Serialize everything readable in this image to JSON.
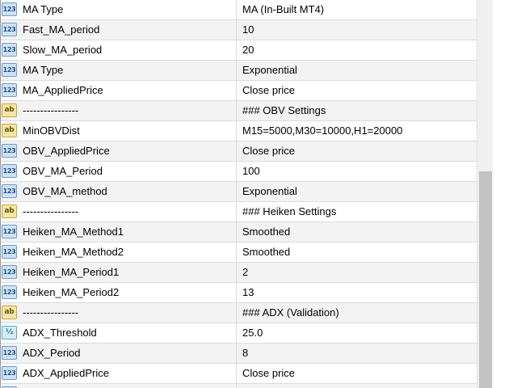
{
  "icon_labels": {
    "int": "123",
    "string": "ab",
    "double": "½"
  },
  "rows": [
    {
      "type": "int",
      "icon_name": "integer-type-icon",
      "name": "MA Type",
      "value": "MA (In-Built MT4)"
    },
    {
      "type": "int",
      "icon_name": "integer-type-icon",
      "name": "Fast_MA_period",
      "value": "10"
    },
    {
      "type": "int",
      "icon_name": "integer-type-icon",
      "name": "Slow_MA_period",
      "value": "20"
    },
    {
      "type": "int",
      "icon_name": "integer-type-icon",
      "name": "MA Type",
      "value": "Exponential"
    },
    {
      "type": "int",
      "icon_name": "integer-type-icon",
      "name": "MA_AppliedPrice",
      "value": "Close price"
    },
    {
      "type": "string",
      "icon_name": "string-type-icon",
      "name": "----------------",
      "value": "### OBV Settings"
    },
    {
      "type": "string",
      "icon_name": "string-type-icon",
      "name": "MinOBVDist",
      "value": "M15=5000,M30=10000,H1=20000"
    },
    {
      "type": "int",
      "icon_name": "integer-type-icon",
      "name": "OBV_AppliedPrice",
      "value": "Close price"
    },
    {
      "type": "int",
      "icon_name": "integer-type-icon",
      "name": "OBV_MA_Period",
      "value": "100"
    },
    {
      "type": "int",
      "icon_name": "integer-type-icon",
      "name": "OBV_MA_method",
      "value": "Exponential"
    },
    {
      "type": "string",
      "icon_name": "string-type-icon",
      "name": "----------------",
      "value": "### Heiken Settings"
    },
    {
      "type": "int",
      "icon_name": "integer-type-icon",
      "name": "Heiken_MA_Method1",
      "value": "Smoothed"
    },
    {
      "type": "int",
      "icon_name": "integer-type-icon",
      "name": "Heiken_MA_Method2",
      "value": "Smoothed"
    },
    {
      "type": "int",
      "icon_name": "integer-type-icon",
      "name": "Heiken_MA_Period1",
      "value": "2"
    },
    {
      "type": "int",
      "icon_name": "integer-type-icon",
      "name": "Heiken_MA_Period2",
      "value": "13"
    },
    {
      "type": "string",
      "icon_name": "string-type-icon",
      "name": "----------------",
      "value": "### ADX (Validation)"
    },
    {
      "type": "double",
      "icon_name": "double-type-icon",
      "name": "ADX_Threshold",
      "value": "25.0"
    },
    {
      "type": "int",
      "icon_name": "integer-type-icon",
      "name": "ADX_Period",
      "value": "8"
    },
    {
      "type": "int",
      "icon_name": "integer-type-icon",
      "name": "ADX_AppliedPrice",
      "value": "Close price"
    },
    {
      "type": "int",
      "icon_name": "integer-type-icon",
      "name": "",
      "value": ""
    }
  ]
}
